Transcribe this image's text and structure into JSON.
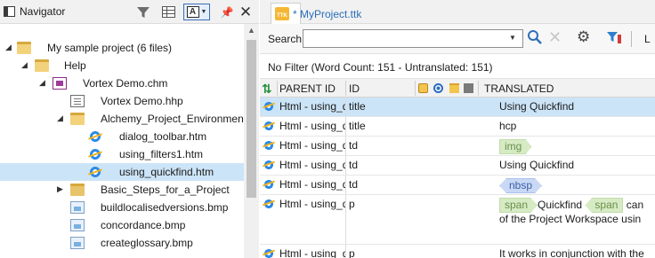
{
  "navigator": {
    "title": "Navigator",
    "view_label": "A",
    "pin": "⌑",
    "close": "✕",
    "tree": [
      {
        "label": "My sample project (6 files)",
        "type": "folder-open",
        "expanded": true
      },
      {
        "label": "Help",
        "type": "folder-open",
        "expanded": true
      },
      {
        "label": "Vortex Demo.chm",
        "type": "chm",
        "expanded": true
      },
      {
        "label": "Vortex Demo.hhp",
        "type": "hhp"
      },
      {
        "label": "Alchemy_Project_Environment",
        "type": "folder-open",
        "expanded": true
      },
      {
        "label": "dialog_toolbar.htm",
        "type": "htm"
      },
      {
        "label": "using_filters1.htm",
        "type": "htm"
      },
      {
        "label": "using_quickfind.htm",
        "type": "htm",
        "selected": true
      },
      {
        "label": "Basic_Steps_for_a_Project",
        "type": "folder",
        "expanded": false
      },
      {
        "label": "buildlocalisedversions.bmp",
        "type": "bmp"
      },
      {
        "label": "concordance.bmp",
        "type": "bmp"
      },
      {
        "label": "createglossary.bmp",
        "type": "bmp"
      }
    ]
  },
  "editor": {
    "tab_label": "* MyProject.ttk",
    "tab_icon_text": "TTK",
    "search_label": "Search",
    "search_value": "",
    "toolbar_more": "L",
    "filter_status": "No Filter (Word Count: 151 - Untranslated: 151)",
    "columns": {
      "parent_id": "PARENT ID",
      "id": "ID",
      "translated": "TRANSLATED"
    },
    "rows": [
      {
        "parent": "Html - using_quickfind",
        "id": "title",
        "translated": "Using Quickfind",
        "selected": true
      },
      {
        "parent": "Html - using_quickfind",
        "id": "title",
        "translated": "hcp"
      },
      {
        "parent": "Html - using_quickfind",
        "id": "td",
        "tag": "img"
      },
      {
        "parent": "Html - using_quickfind",
        "id": "td",
        "translated": "Using Quickfind"
      },
      {
        "parent": "Html - using_quickfind",
        "id": "td",
        "tag": "nbsp"
      },
      {
        "parent": "Html - using_quickfind",
        "id": "p",
        "tag_open": "span",
        "text_a": "Quickfind",
        "tag_close": "span",
        "text_b": "can",
        "line2": "of the Project Workspace usin"
      },
      {
        "parent": "Html - using_quickfind",
        "id": "p",
        "translated": "It works in conjunction with the"
      }
    ]
  }
}
